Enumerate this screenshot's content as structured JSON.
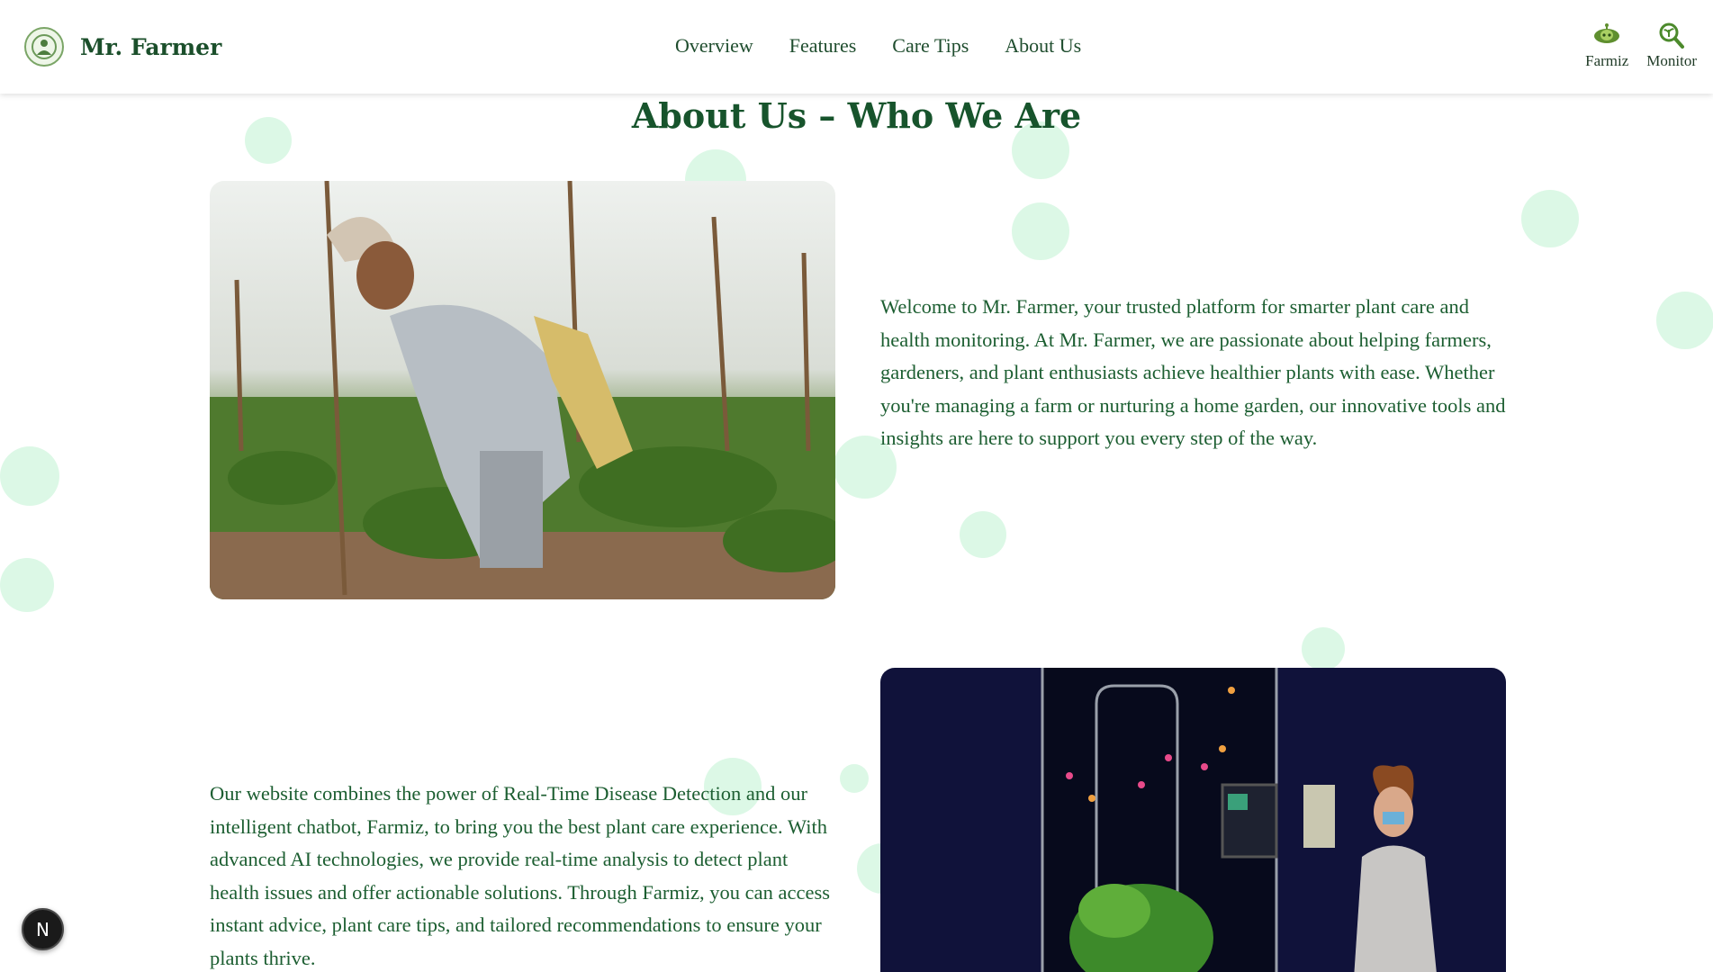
{
  "header": {
    "brand": "Mr. Farmer",
    "nav": [
      {
        "label": "Overview"
      },
      {
        "label": "Features"
      },
      {
        "label": "Care Tips"
      },
      {
        "label": "About Us"
      }
    ],
    "tools": [
      {
        "label": "Farmiz",
        "icon": "chatbot-icon"
      },
      {
        "label": "Monitor",
        "icon": "magnifier-plant-icon"
      }
    ]
  },
  "main": {
    "title": "About Us – Who We Are",
    "para1": "Welcome to Mr. Farmer, your trusted platform for smarter plant care and health monitoring. At Mr. Farmer, we are passionate about helping farmers, gardeners, and plant enthusiasts achieve healthier plants with ease. Whether you're managing a farm or nurturing a home garden, our innovative tools and insights are here to support you every step of the way.",
    "para2": "Our website combines the power of Real-Time Disease Detection and our intelligent chatbot, Farmiz, to bring you the best plant care experience. With advanced AI technologies, we provide real-time analysis to detect plant health issues and offer actionable solutions. Through Farmiz, you can access instant advice, plant care tips, and tailored recommendations to ensure your plants thrive."
  },
  "badge": {
    "label": "N"
  },
  "colors": {
    "primary": "#1c5e31",
    "bubble": "#d8f7e3"
  }
}
